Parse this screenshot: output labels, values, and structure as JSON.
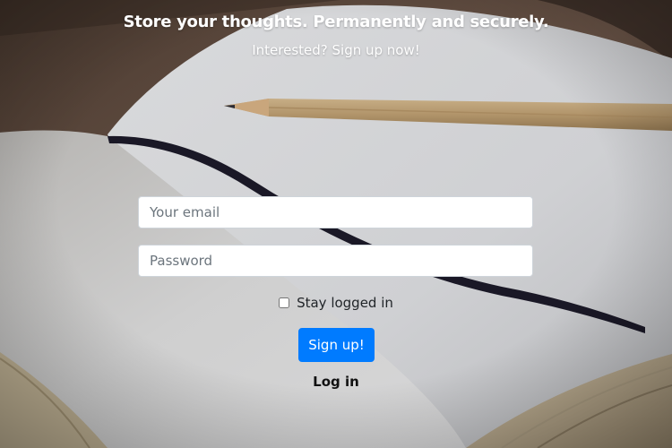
{
  "hero": {
    "tagline": "Store your thoughts. Permanently and securely.",
    "subline": "Interested? Sign up now!"
  },
  "form": {
    "email_placeholder": "Your email",
    "password_placeholder": "Password",
    "remember_label": "Stay logged in",
    "remember_checked": false,
    "signup_label": "Sign up!",
    "login_label": "Log in"
  },
  "colors": {
    "primary_button": "#007bff",
    "heading_text": "#ffffff",
    "body_text": "#212529"
  }
}
